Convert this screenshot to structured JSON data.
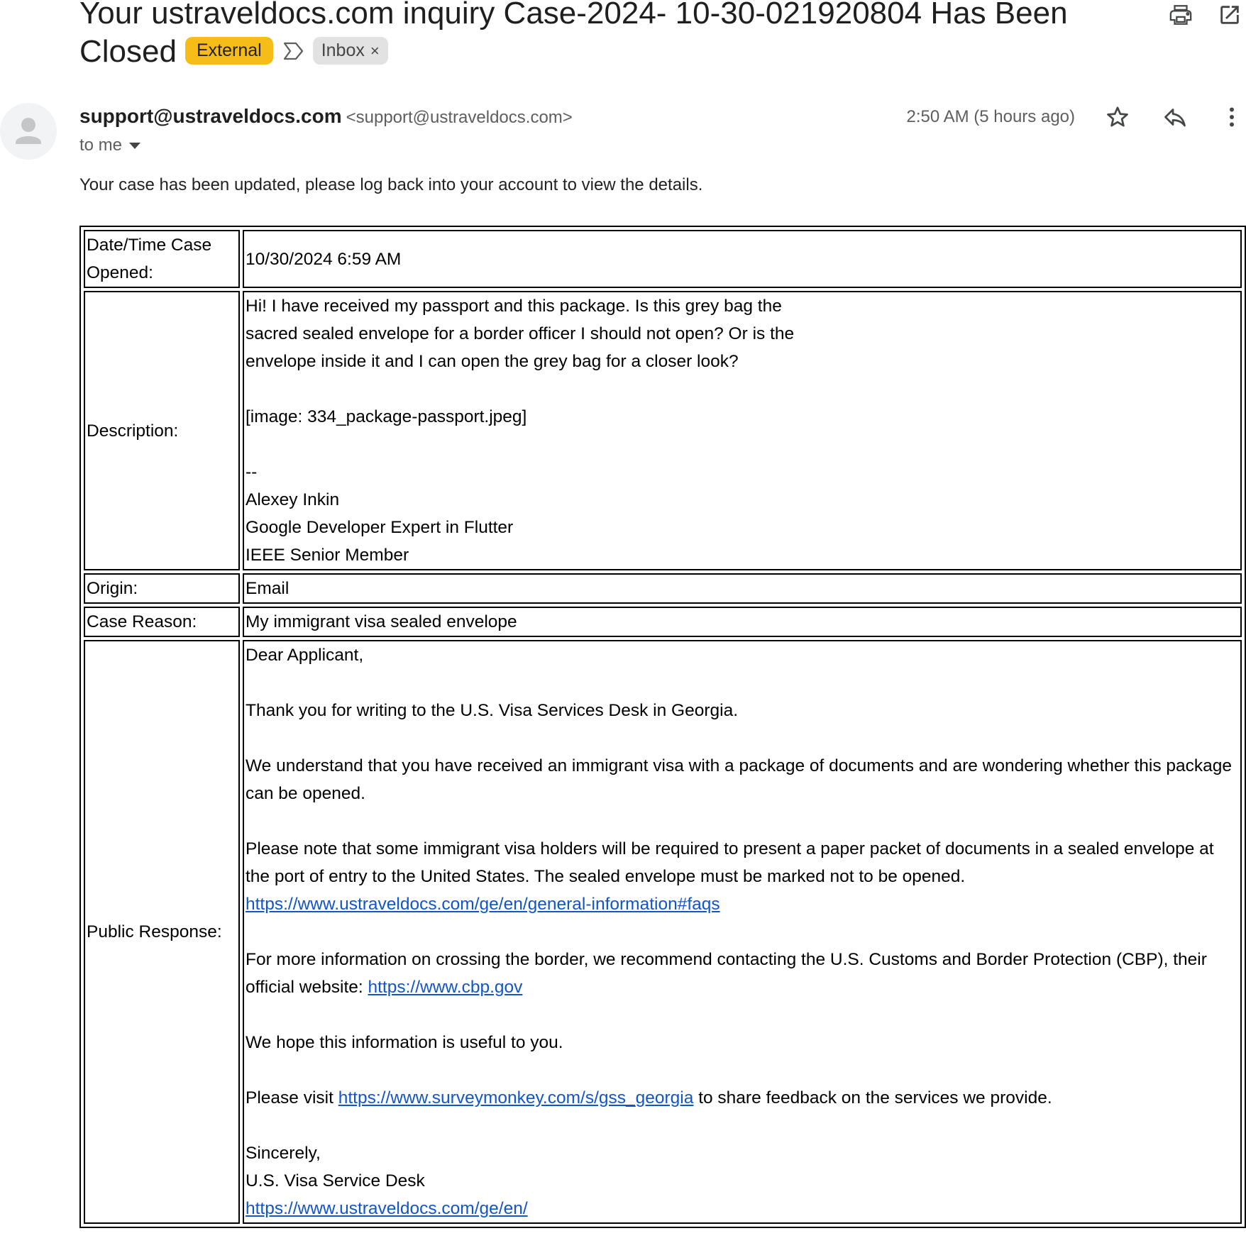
{
  "subject": {
    "text": "Your ustraveldocs.com inquiry Case-2024- 10-30-021920804 Has Been Closed",
    "external_label": "External",
    "inbox_label": "Inbox",
    "inbox_remove": "×"
  },
  "icons": {
    "importance": "importance-marker-icon",
    "print": "printer-icon",
    "open_new": "open-in-new-window-icon",
    "avatar": "person-avatar-icon",
    "star": "star-icon",
    "reply": "reply-icon",
    "more": "more-vertical-icon",
    "dropdown": "caret-down-icon"
  },
  "sender": {
    "name": "support@ustraveldocs.com",
    "email": "<support@ustraveldocs.com>",
    "to": "to me",
    "time": "2:50 AM (5 hours ago)"
  },
  "body": {
    "intro": "Your case has been updated, please log back into your account to view the details."
  },
  "case": {
    "opened_label": "Date/Time Case Opened:",
    "opened_value": "10/30/2024 6:59 AM",
    "description_label": "Description:",
    "description_lines": [
      "Hi! I have received my passport and this package. Is this grey bag the",
      "sacred sealed envelope for a border officer I should not open? Or is the",
      "envelope inside it and I can open the grey bag for a closer look?",
      "",
      "[image: 334_package-passport.jpeg]",
      "",
      "--",
      "Alexey Inkin",
      "Google Developer Expert in Flutter",
      "IEEE Senior Member"
    ],
    "origin_label": "Origin:",
    "origin_value": "Email",
    "reason_label": "Case Reason:",
    "reason_value": "My immigrant visa sealed envelope",
    "response_label": "Public Response:",
    "response": {
      "greeting": "Dear Applicant,",
      "thanks": "Thank you for writing to the U.S. Visa Services Desk in Georgia.",
      "understand": "We understand that you have received an immigrant visa with a package of documents and are wondering whether this package can be opened.",
      "note": "Please note that some immigrant visa holders will be required to present a paper packet of documents in a sealed envelope at the port of entry to the United States. The sealed envelope must be marked not to be opened.",
      "note_link": "https://www.ustraveldocs.com/ge/en/general-information#faqs",
      "cbp_text": "For more information on crossing the border, we recommend contacting the U.S. Customs and Border Protection (CBP), their official website:",
      "cbp_link": "https://www.cbp.gov",
      "hope": "We hope this information is useful to you.",
      "survey_pre": "Please visit",
      "survey_link": "https://www.surveymonkey.com/s/gss_georgia",
      "survey_post": "to share feedback on the services we provide.",
      "sincerely": "Sincerely,",
      "desk": "U.S. Visa Service Desk",
      "desk_link": "https://www.ustraveldocs.com/ge/en/"
    }
  },
  "colors": {
    "external_badge": "#f6bd18",
    "inbox_badge": "#e2e2e2",
    "link": "#1155cc"
  }
}
